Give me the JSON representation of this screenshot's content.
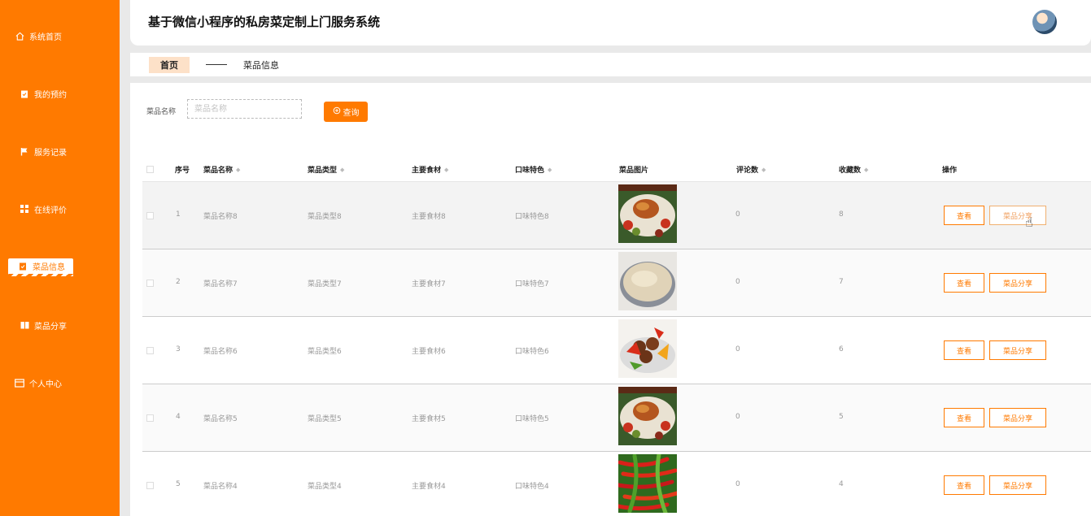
{
  "sidebar": {
    "items": [
      {
        "label": "系统首页",
        "icon": "home-icon"
      },
      {
        "label": "我的预约",
        "icon": "clipboard-icon"
      },
      {
        "label": "服务记录",
        "icon": "flag-icon"
      },
      {
        "label": "在线评价",
        "icon": "grid-icon"
      },
      {
        "label": "菜品信息",
        "icon": "clipboard-icon",
        "active": true
      },
      {
        "label": "菜品分享",
        "icon": "book-icon"
      },
      {
        "label": "个人中心",
        "icon": "card-icon"
      }
    ]
  },
  "header": {
    "title": "基于微信小程序的私房菜定制上门服务系统"
  },
  "breadcrumb": {
    "home": "首页",
    "current": "菜品信息"
  },
  "search": {
    "label": "菜品名称",
    "placeholder": "菜品名称",
    "button": "查询"
  },
  "table": {
    "headers": [
      "序号",
      "菜品名称",
      "菜品类型",
      "主要食材",
      "口味特色",
      "菜品图片",
      "评论数",
      "收藏数",
      "操作"
    ],
    "rows": [
      {
        "index": "1",
        "name": "菜品名称8",
        "type": "菜品类型8",
        "ingredient": "主要食材8",
        "flavor": "口味特色8",
        "image": "roast-platter",
        "comments": "0",
        "favorites": "8"
      },
      {
        "index": "2",
        "name": "菜品名称7",
        "type": "菜品类型7",
        "ingredient": "主要食材7",
        "flavor": "口味特色7",
        "image": "rice-bowl",
        "comments": "0",
        "favorites": "7"
      },
      {
        "index": "3",
        "name": "菜品名称6",
        "type": "菜品类型6",
        "ingredient": "主要食材6",
        "flavor": "口味特色6",
        "image": "meatball-peppers",
        "comments": "0",
        "favorites": "6"
      },
      {
        "index": "4",
        "name": "菜品名称5",
        "type": "菜品类型5",
        "ingredient": "主要食材5",
        "flavor": "口味特色5",
        "image": "roast-platter",
        "comments": "0",
        "favorites": "5"
      },
      {
        "index": "5",
        "name": "菜品名称4",
        "type": "菜品类型4",
        "ingredient": "主要食材4",
        "flavor": "口味特色4",
        "image": "chili-peppers",
        "comments": "0",
        "favorites": "4"
      }
    ],
    "view_label": "查看",
    "share_label": "菜品分享"
  },
  "colors": {
    "accent": "#ff7a00",
    "sidebar": "#ff7a00"
  }
}
